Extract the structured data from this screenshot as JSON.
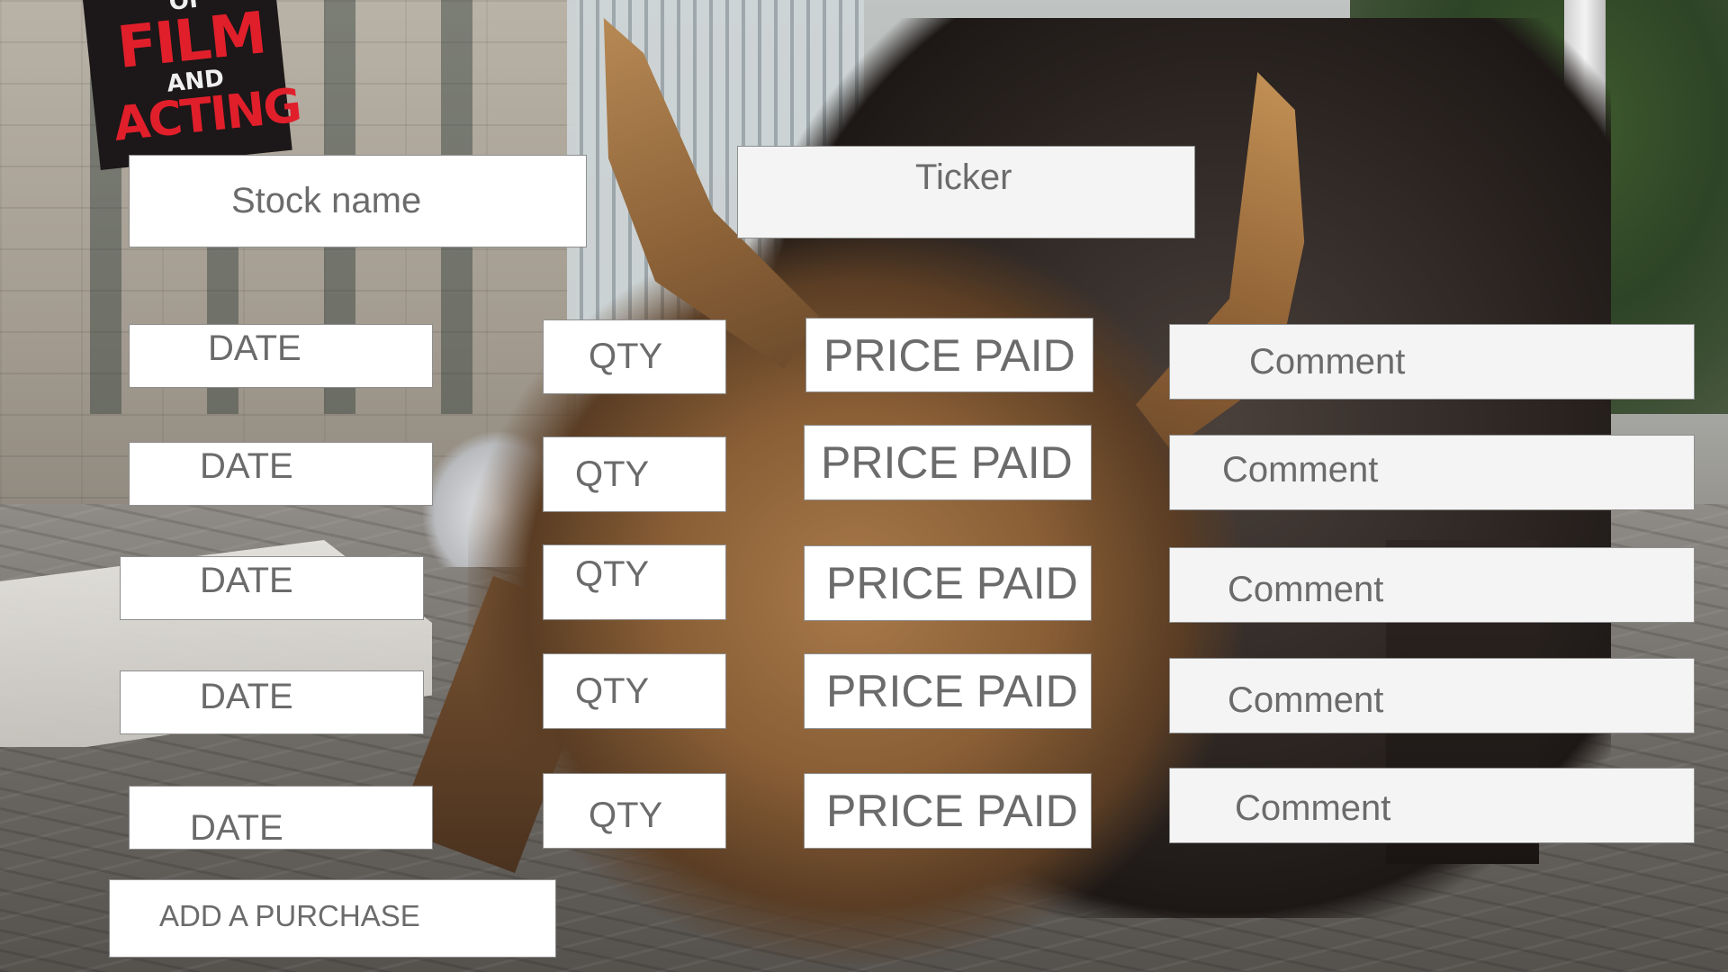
{
  "background": {
    "sign": {
      "line1": "OF",
      "line2": "FILM",
      "line3": "AND",
      "line4": "ACTING"
    }
  },
  "form": {
    "stock_name_placeholder": "Stock name",
    "ticker_placeholder": "Ticker",
    "purchases": [
      {
        "date": "DATE",
        "qty": "QTY",
        "price_paid": "PRICE PAID",
        "comment": "Comment"
      },
      {
        "date": "DATE",
        "qty": "QTY",
        "price_paid": "PRICE PAID",
        "comment": "Comment"
      },
      {
        "date": "DATE",
        "qty": "QTY",
        "price_paid": "PRICE PAID",
        "comment": "Comment"
      },
      {
        "date": "DATE",
        "qty": "QTY",
        "price_paid": "PRICE PAID",
        "comment": "Comment"
      },
      {
        "date": "DATE",
        "qty": "QTY",
        "price_paid": "PRICE PAID",
        "comment": "Comment"
      }
    ],
    "add_purchase_label": "ADD A PURCHASE"
  },
  "colors": {
    "field_text": "#6b6b6b",
    "field_bg": "#ffffff",
    "field_bg_alt": "#f4f4f4",
    "field_border": "#8e8e8e"
  }
}
